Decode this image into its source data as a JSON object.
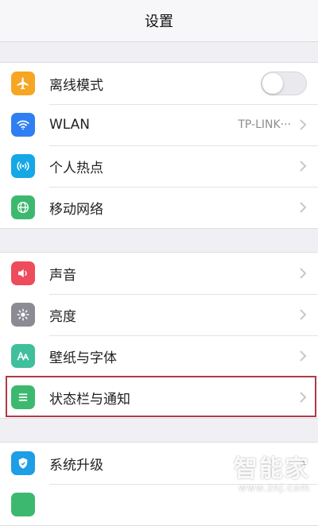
{
  "header": {
    "title": "设置"
  },
  "groups": [
    {
      "items": [
        {
          "label": "离线模式",
          "icon": "airplane-icon",
          "icon_bg": "#f6a623",
          "toggle_on": false
        },
        {
          "label": "WLAN",
          "icon": "wifi-icon",
          "icon_bg": "#2f7ff2",
          "value": "TP-LINK···"
        },
        {
          "label": "个人热点",
          "icon": "hotspot-icon",
          "icon_bg": "#15a7e6"
        },
        {
          "label": "移动网络",
          "icon": "globe-icon",
          "icon_bg": "#3cb96f"
        }
      ]
    },
    {
      "items": [
        {
          "label": "声音",
          "icon": "speaker-icon",
          "icon_bg": "#ee4b5c"
        },
        {
          "label": "亮度",
          "icon": "brightness-icon",
          "icon_bg": "#8b8b93"
        },
        {
          "label": "壁纸与字体",
          "icon": "font-icon",
          "icon_bg": "#3fbf9b"
        },
        {
          "label": "状态栏与通知",
          "icon": "list-icon",
          "icon_bg": "#3cb96f"
        }
      ]
    },
    {
      "items": [
        {
          "label": "系统升级",
          "icon": "shield-icon",
          "icon_bg": "#1e9ee6"
        },
        {
          "label": "",
          "icon": "partial-icon",
          "icon_bg": "#3cb96f"
        }
      ]
    }
  ],
  "watermark": {
    "main": "智能家",
    "url": "www.znj.com"
  }
}
